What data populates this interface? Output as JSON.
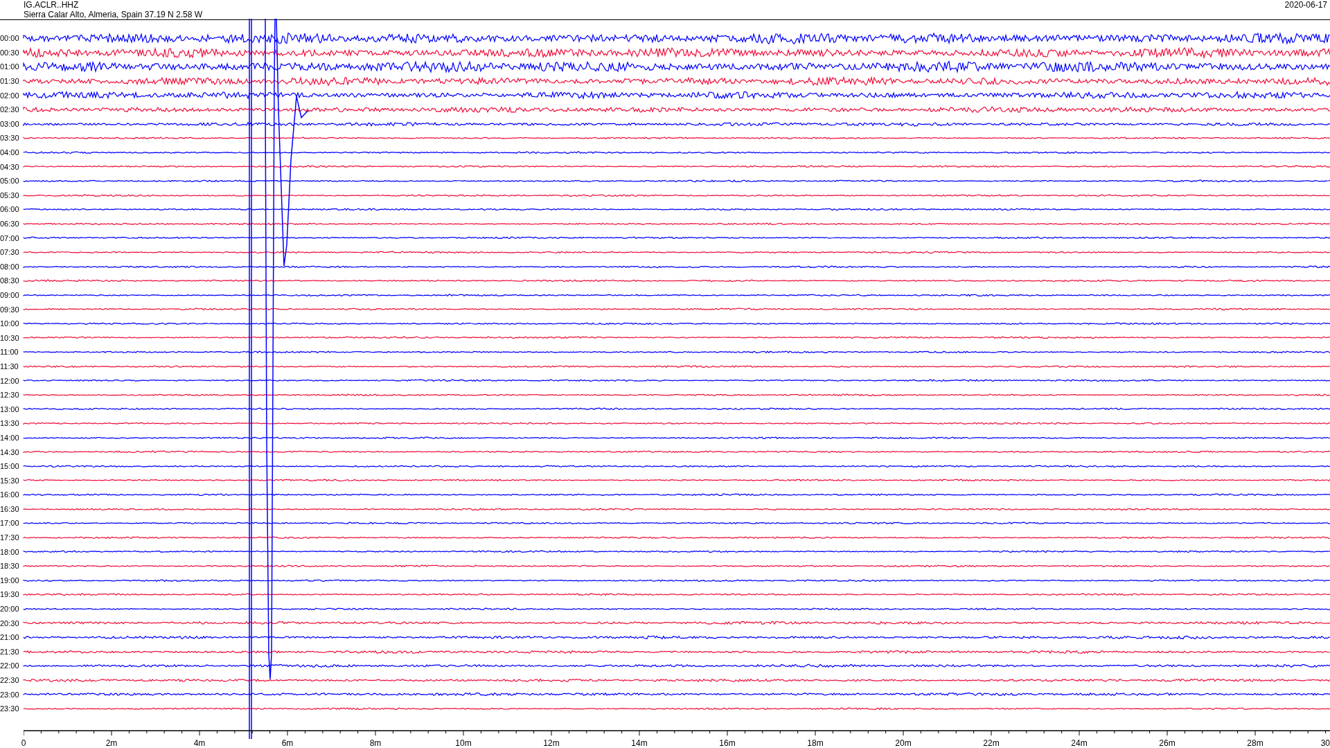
{
  "header": {
    "station": "IG.ACLR..HHZ",
    "location": "Sierra Calar Alto, Almeria, Spain  37.19 N 2.58 W",
    "date": "2020-06-17"
  },
  "rows": [
    {
      "label": "00:00",
      "color": "#0000ff"
    },
    {
      "label": "00:30",
      "color": "#f0103c"
    },
    {
      "label": "01:00",
      "color": "#0000ff"
    },
    {
      "label": "01:30",
      "color": "#f0103c"
    },
    {
      "label": "02:00",
      "color": "#0000ff"
    },
    {
      "label": "02:30",
      "color": "#f0103c"
    },
    {
      "label": "03:00",
      "color": "#0000ff"
    },
    {
      "label": "03:30",
      "color": "#f0103c"
    },
    {
      "label": "04:00",
      "color": "#0000ff"
    },
    {
      "label": "04:30",
      "color": "#f0103c"
    },
    {
      "label": "05:00",
      "color": "#0000ff"
    },
    {
      "label": "05:30",
      "color": "#f0103c"
    },
    {
      "label": "06:00",
      "color": "#0000ff"
    },
    {
      "label": "06:30",
      "color": "#f0103c"
    },
    {
      "label": "07:00",
      "color": "#0000ff"
    },
    {
      "label": "07:30",
      "color": "#f0103c"
    },
    {
      "label": "08:00",
      "color": "#0000ff"
    },
    {
      "label": "08:30",
      "color": "#f0103c"
    },
    {
      "label": "09:00",
      "color": "#0000ff"
    },
    {
      "label": "09:30",
      "color": "#f0103c"
    },
    {
      "label": "10:00",
      "color": "#0000ff"
    },
    {
      "label": "10:30",
      "color": "#f0103c"
    },
    {
      "label": "11:00",
      "color": "#0000ff"
    },
    {
      "label": "11:30",
      "color": "#f0103c"
    },
    {
      "label": "12:00",
      "color": "#0000ff"
    },
    {
      "label": "12:30",
      "color": "#f0103c"
    },
    {
      "label": "13:00",
      "color": "#0000ff"
    },
    {
      "label": "13:30",
      "color": "#f0103c"
    },
    {
      "label": "14:00",
      "color": "#0000ff"
    },
    {
      "label": "14:30",
      "color": "#f0103c"
    },
    {
      "label": "15:00",
      "color": "#0000ff"
    },
    {
      "label": "15:30",
      "color": "#f0103c"
    },
    {
      "label": "16:00",
      "color": "#0000ff"
    },
    {
      "label": "16:30",
      "color": "#f0103c"
    },
    {
      "label": "17:00",
      "color": "#0000ff"
    },
    {
      "label": "17:30",
      "color": "#f0103c"
    },
    {
      "label": "18:00",
      "color": "#0000ff"
    },
    {
      "label": "18:30",
      "color": "#f0103c"
    },
    {
      "label": "19:00",
      "color": "#0000ff"
    },
    {
      "label": "19:30",
      "color": "#f0103c"
    },
    {
      "label": "20:00",
      "color": "#0000ff"
    },
    {
      "label": "20:30",
      "color": "#f0103c"
    },
    {
      "label": "21:00",
      "color": "#0000ff"
    },
    {
      "label": "21:30",
      "color": "#f0103c"
    },
    {
      "label": "22:00",
      "color": "#0000ff"
    },
    {
      "label": "22:30",
      "color": "#f0103c"
    },
    {
      "label": "23:00",
      "color": "#0000ff"
    },
    {
      "label": "23:30",
      "color": "#f0103c"
    }
  ],
  "axis": {
    "ticks": [
      "0",
      "2m",
      "4m",
      "6m",
      "8m",
      "10m",
      "12m",
      "14m",
      "16m",
      "18m",
      "20m",
      "22m",
      "24m",
      "26m",
      "28m",
      "30"
    ]
  }
}
